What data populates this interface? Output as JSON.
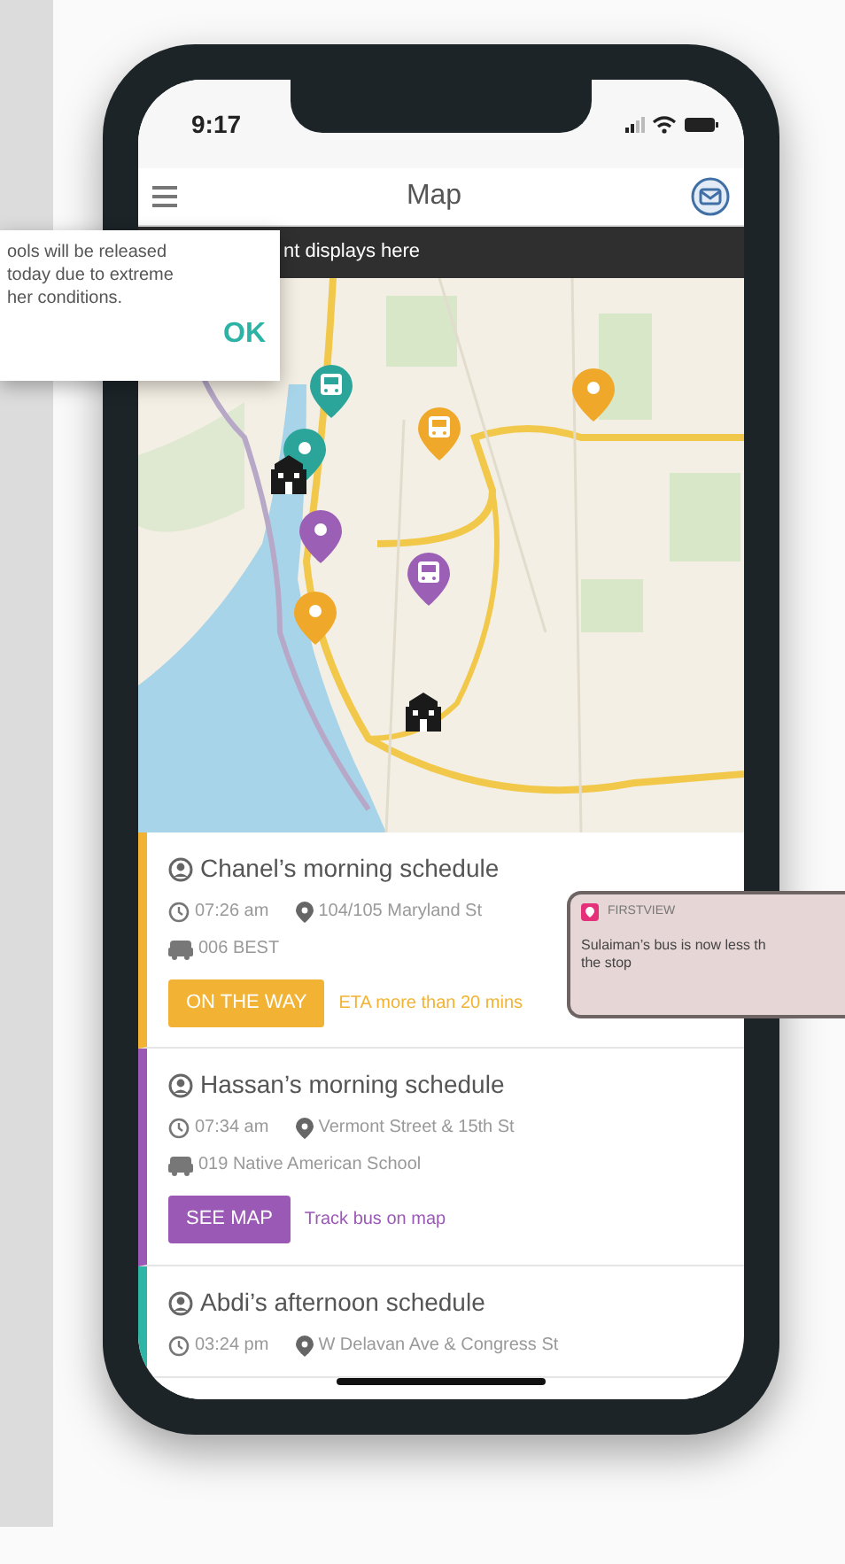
{
  "status_bar": {
    "time": "9:17"
  },
  "header": {
    "title": "Map"
  },
  "banner": {
    "text": "nt displays here"
  },
  "alert": {
    "lines": [
      "ools will be released",
      "today due to extreme",
      "her conditions."
    ],
    "button": "OK"
  },
  "map": {
    "markers": [
      {
        "kind": "bus",
        "color": "#2ba59a"
      },
      {
        "kind": "pin",
        "color": "#2ba59a"
      },
      {
        "kind": "bus",
        "color": "#f0a82a"
      },
      {
        "kind": "pin",
        "color": "#f0a82a"
      },
      {
        "kind": "pin",
        "color": "#9b5fb5"
      },
      {
        "kind": "bus",
        "color": "#9b5fb5"
      },
      {
        "kind": "pin",
        "color": "#f0a82a"
      },
      {
        "kind": "school"
      },
      {
        "kind": "school"
      }
    ]
  },
  "schedules": [
    {
      "title": "Chanel’s morning schedule",
      "time": "07:26 am",
      "stop": "104/105 Maryland St",
      "bus": "006 BEST",
      "color": "#f2b233",
      "action": "ON THE WAY",
      "note": "ETA more than 20 mins"
    },
    {
      "title": "Hassan’s morning schedule",
      "time": "07:34 am",
      "stop": "Vermont Street & 15th St",
      "bus": "019 Native American School",
      "color": "#9b59b6",
      "action": "SEE MAP",
      "note": "Track bus on map"
    },
    {
      "title": "Abdi’s afternoon schedule",
      "time": "03:24 pm",
      "stop": "W Delavan Ave & Congress St",
      "color": "#2fb5a5"
    }
  ],
  "notification": {
    "app": "FIRSTVIEW",
    "lines": [
      "Sulaiman’s bus is now less th",
      "the stop"
    ]
  }
}
